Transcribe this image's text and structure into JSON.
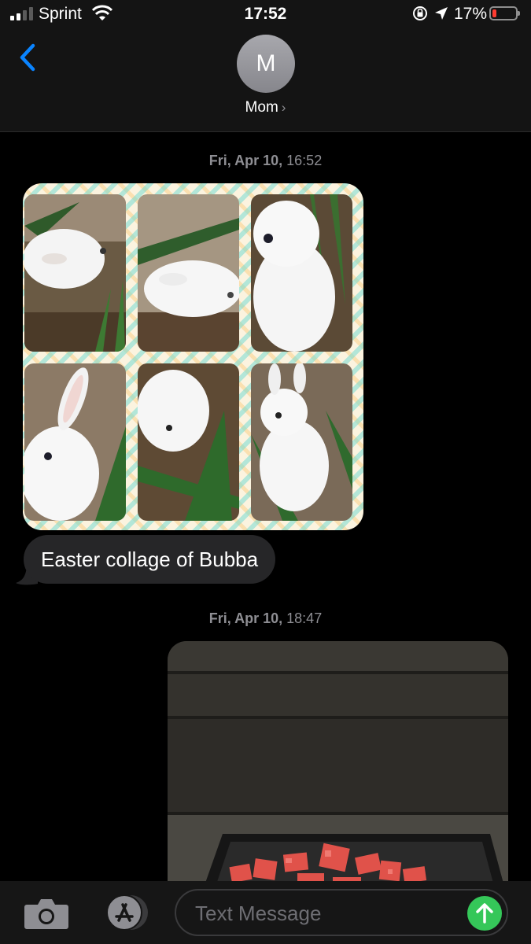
{
  "status_bar": {
    "carrier": "Sprint",
    "time": "17:52",
    "battery_percent": "17%",
    "battery_level": 0.17,
    "signal_bars": 4,
    "signal_bars_on": 2
  },
  "header": {
    "avatar_initial": "M",
    "contact_name": "Mom",
    "chevron": "›"
  },
  "messages": [
    {
      "timestamp_day": "Fri, Apr 10,",
      "timestamp_time": "16:52",
      "attachment": "image",
      "text": "Easter collage of Bubba"
    },
    {
      "timestamp_day": "Fri, Apr 10,",
      "timestamp_time": "18:47",
      "attachment": "image"
    }
  ],
  "composer": {
    "placeholder": "Text Message"
  },
  "colors": {
    "accent": "#0a84ff",
    "send": "#35c759",
    "bubble_received": "#262628",
    "battery_low": "#ff3b30"
  }
}
